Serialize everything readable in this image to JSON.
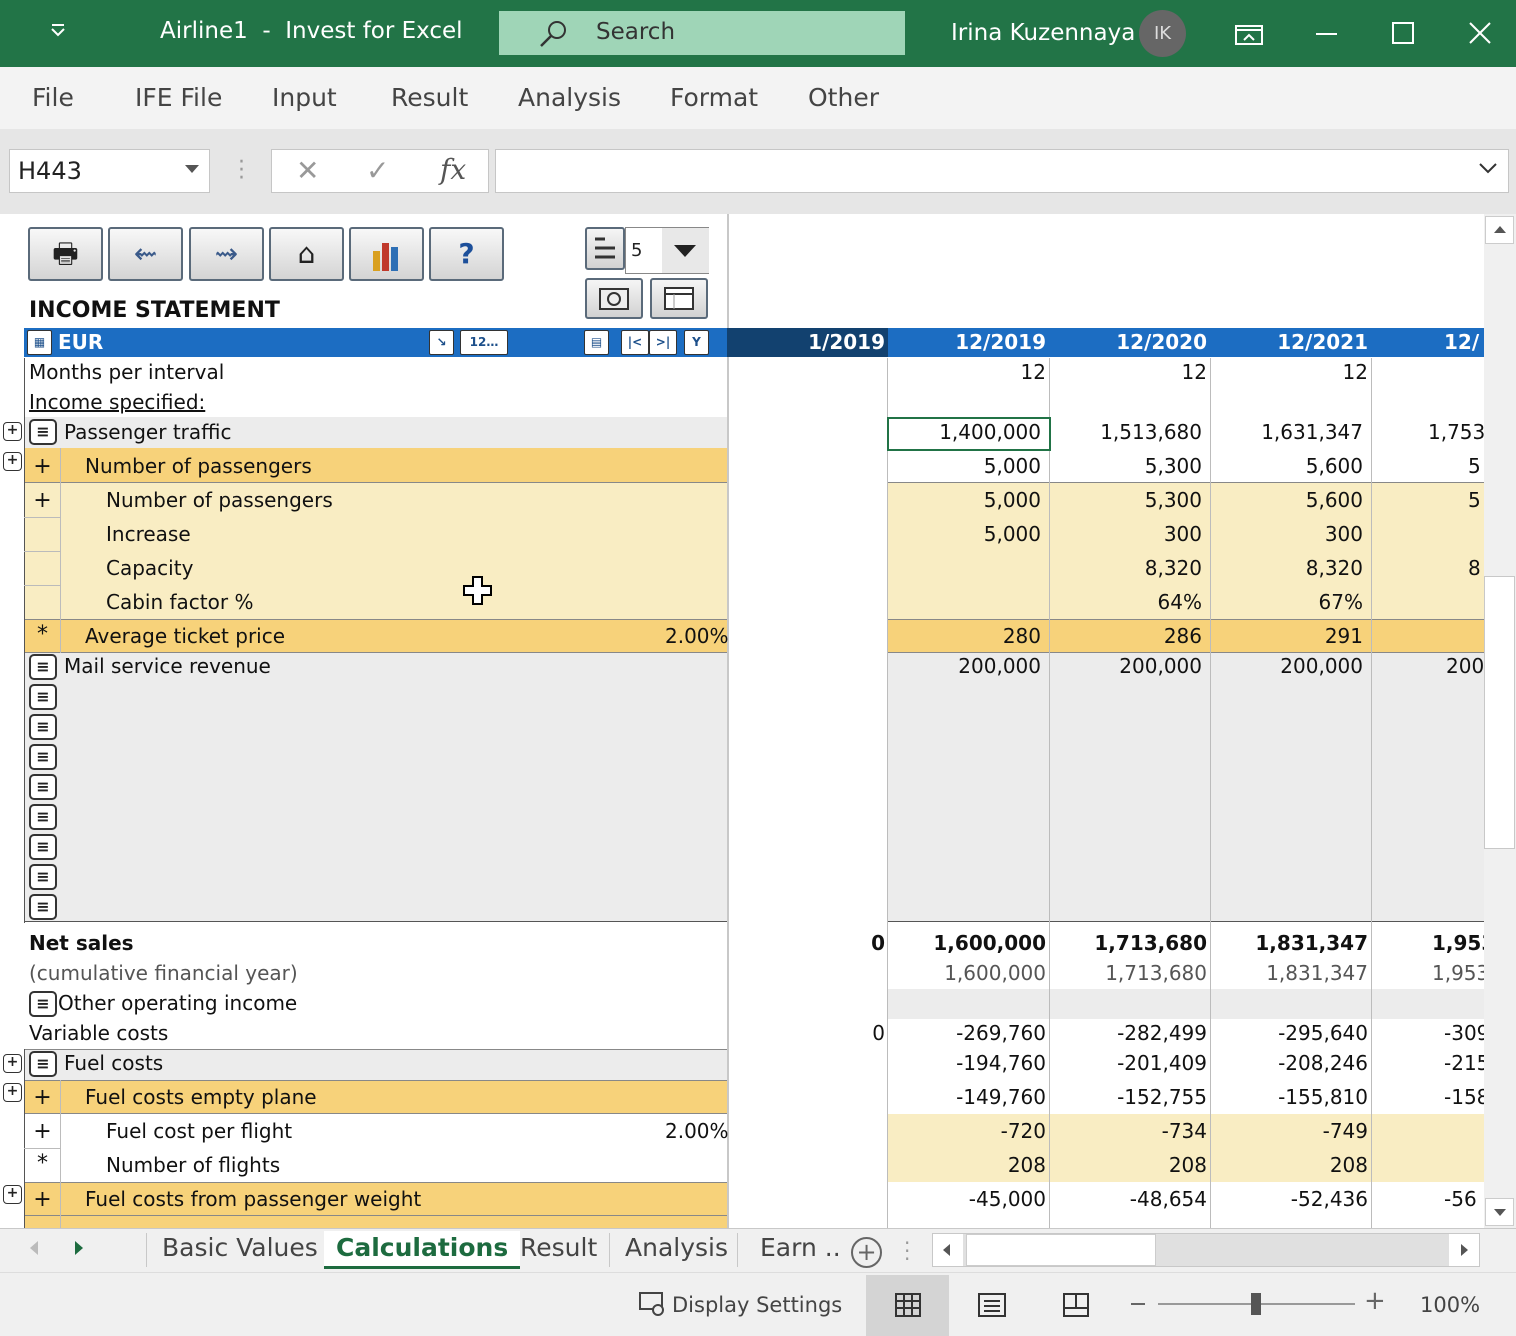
{
  "window": {
    "title": "Airline1  -  Invest for Excel",
    "search_placeholder": "Search",
    "user_name": "Irina Kuzennaya",
    "user_initials": "IK"
  },
  "menu": [
    "File",
    "IFE File",
    "Input",
    "Result",
    "Analysis",
    "Format",
    "Other"
  ],
  "formula_bar": {
    "cell_ref": "H443",
    "fx_label": "fx",
    "formula": ""
  },
  "sheet": {
    "title": "INCOME STATEMENT",
    "level_value": "5",
    "currency": "EUR",
    "header_dates": [
      "1/2019",
      "12/2019",
      "12/2020",
      "12/2021",
      "12/"
    ],
    "rows": [
      {
        "label": "Months per interval",
        "values": [
          "",
          "12",
          "12",
          "12",
          ""
        ]
      },
      {
        "label": "Income specified:",
        "values": [
          "",
          "",
          "",
          "",
          ""
        ]
      },
      {
        "label": "Passenger traffic",
        "values": [
          "",
          "1,400,000",
          "1,513,680",
          "1,631,347",
          "1,753"
        ]
      },
      {
        "label": "Number of passengers",
        "sign": "+",
        "values": [
          "",
          "5,000",
          "5,300",
          "5,600",
          "5"
        ]
      },
      {
        "label": "Number of passengers",
        "sign": "+",
        "values": [
          "",
          "5,000",
          "5,300",
          "5,600",
          "5"
        ]
      },
      {
        "label": "Increase",
        "sign": "",
        "values": [
          "",
          "5,000",
          "300",
          "300",
          ""
        ]
      },
      {
        "label": "Capacity",
        "sign": "",
        "values": [
          "",
          "",
          "8,320",
          "8,320",
          "8"
        ]
      },
      {
        "label": "Cabin factor %",
        "sign": "",
        "values": [
          "",
          "",
          "64%",
          "67%",
          ""
        ]
      },
      {
        "label": "Average ticket price",
        "sign": "*",
        "pct": "2.00%",
        "values": [
          "",
          "280",
          "286",
          "291",
          ""
        ]
      },
      {
        "label": "Mail service revenue",
        "values": [
          "",
          "200,000",
          "200,000",
          "200,000",
          "200"
        ]
      },
      {
        "label": "Net sales",
        "values": [
          "0",
          "1,600,000",
          "1,713,680",
          "1,831,347",
          "1,953"
        ]
      },
      {
        "label": "(cumulative financial year)",
        "values": [
          "",
          "1,600,000",
          "1,713,680",
          "1,831,347",
          "1,953"
        ]
      },
      {
        "label": "Other operating income",
        "values": [
          "",
          "",
          "",
          "",
          ""
        ]
      },
      {
        "label": "Variable costs",
        "values": [
          "0",
          "-269,760",
          "-282,499",
          "-295,640",
          "-309"
        ]
      },
      {
        "label": "Fuel costs",
        "values": [
          "",
          "-194,760",
          "-201,409",
          "-208,246",
          "-215"
        ]
      },
      {
        "label": "Fuel costs empty plane",
        "sign": "+",
        "values": [
          "",
          "-149,760",
          "-152,755",
          "-155,810",
          "-158"
        ]
      },
      {
        "label": "Fuel cost per flight",
        "sign": "+",
        "pct": "2.00%",
        "values": [
          "",
          "-720",
          "-734",
          "-749",
          ""
        ]
      },
      {
        "label": "Number of flights",
        "sign": "*",
        "values": [
          "",
          "208",
          "208",
          "208",
          ""
        ]
      },
      {
        "label": "Fuel costs from passenger weight",
        "sign": "+",
        "values": [
          "",
          "-45,000",
          "-48,654",
          "-52,436",
          "-56"
        ]
      }
    ]
  },
  "sheet_tabs": [
    "Basic Values",
    "Calculations",
    "Result",
    "Analysis",
    "Earn ..."
  ],
  "active_tab": "Calculations",
  "status": {
    "display_settings": "Display Settings",
    "zoom": "100%"
  }
}
